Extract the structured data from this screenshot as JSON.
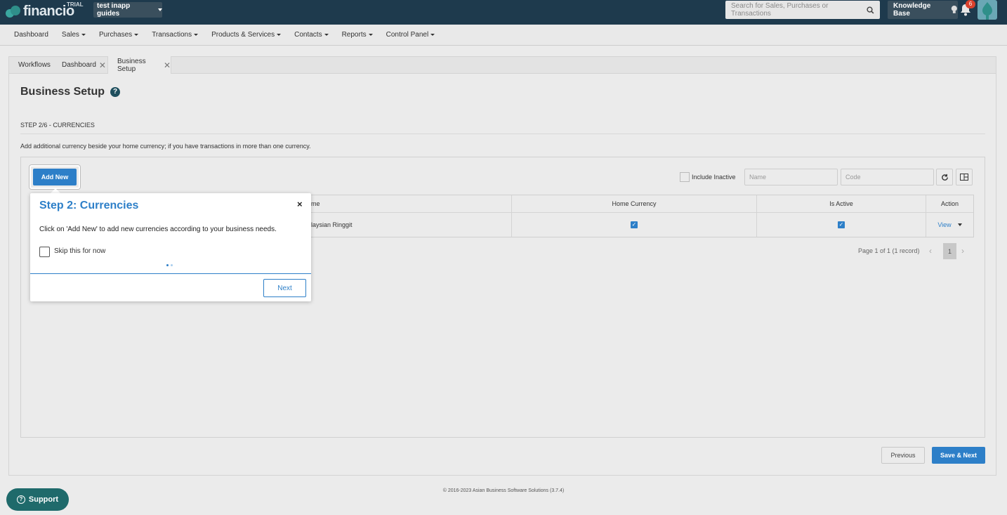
{
  "app": {
    "logo_text": "financio",
    "trial_label": "TRIAL",
    "company": "test inapp guides",
    "search_placeholder": "Search for Sales, Purchases or Transactions",
    "knowledge_base": "Knowledge Base",
    "notification_count": "6"
  },
  "nav": [
    "Dashboard",
    "Sales",
    "Purchases",
    "Transactions",
    "Products & Services",
    "Contacts",
    "Reports",
    "Control Panel"
  ],
  "tabs": [
    {
      "label": "Workflows"
    },
    {
      "label": "Dashboard"
    },
    {
      "label": "Business Setup"
    }
  ],
  "page": {
    "title": "Business Setup",
    "step": "STEP 2/6 - CURRENCIES",
    "description": "Add additional currency beside your home currency; if you have transactions in more than one currency.",
    "add_new": "Add New",
    "include_inactive": "Include Inactive",
    "name_placeholder": "Name",
    "code_placeholder": "Code"
  },
  "table": {
    "columns": [
      "ame",
      "Home Currency",
      "Is Active",
      "Action"
    ],
    "rows": [
      {
        "name": "alaysian Ringgit",
        "home_currency": true,
        "is_active": true,
        "action": "View"
      }
    ],
    "page_info": "Page 1 of 1 (1 record)",
    "current_page": "1"
  },
  "buttons": {
    "previous": "Previous",
    "save_next": "Save & Next"
  },
  "footer": "© 2016-2023 Asian Business Software Solutions (3.7.4)",
  "support": "Support",
  "popover": {
    "title": "Step 2: Currencies",
    "body": "Click on 'Add New' to add new currencies according to your business needs.",
    "skip": "Skip this for now",
    "next": "Next",
    "close": "×"
  },
  "colors": {
    "topbar": "#1e3a4d",
    "accent": "#2d7fc8",
    "support": "#1f6a6b",
    "badge": "#d9412c"
  }
}
